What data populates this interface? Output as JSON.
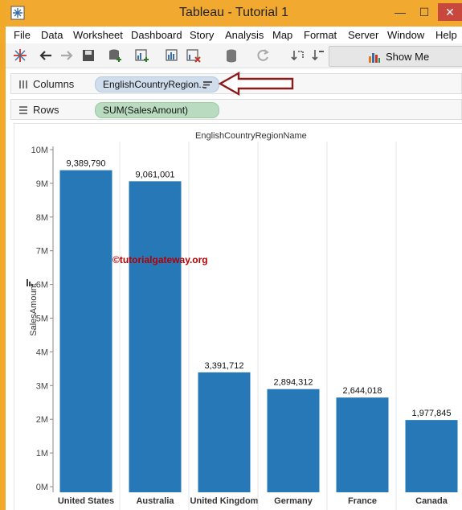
{
  "window": {
    "title": "Tableau - Tutorial 1",
    "minimize_glyph": "—",
    "maximize_glyph": "☐",
    "close_glyph": "✕"
  },
  "menu": [
    "File",
    "Data",
    "Worksheet",
    "Dashboard",
    "Story",
    "Analysis",
    "Map",
    "Format",
    "Server",
    "Window",
    "Help"
  ],
  "toolbar": {
    "icons": [
      "tableau-logo-icon",
      "back-icon",
      "forward-icon",
      "save-icon",
      "new-datasource-icon",
      "new-worksheet-icon",
      "duplicate-sheet-icon",
      "clear-sheet-icon",
      "datasource-icon",
      "refresh-icon",
      "swap-icon",
      "sort-icon"
    ],
    "show_me_label": "Show Me"
  },
  "shelves": {
    "columns": {
      "label": "Columns",
      "pill": "EnglishCountryRegion.."
    },
    "rows": {
      "label": "Rows",
      "pill": "SUM(SalesAmount)"
    }
  },
  "watermark": "©tutorialgateway.org",
  "colors": {
    "bar": "#2778b7",
    "titlebar": "#f2a930",
    "arrow": "#8b1a1a",
    "rows_pill": "#b9dcc1",
    "columns_pill": "#cfddec"
  },
  "chart_data": {
    "type": "bar",
    "title": "EnglishCountryRegionName",
    "xlabel": "",
    "ylabel": "SalesAmount",
    "categories": [
      "United States",
      "Australia",
      "United Kingdom",
      "Germany",
      "France",
      "Canada"
    ],
    "values": [
      9389790,
      9061001,
      3391712,
      2894312,
      2644018,
      1977845
    ],
    "data_labels": [
      "9,389,790",
      "9,061,001",
      "3,391,712",
      "2,894,312",
      "2,644,018",
      "1,977,845"
    ],
    "ylim": [
      0,
      10000000
    ],
    "yticks": [
      {
        "value": 0,
        "label": "0M"
      },
      {
        "value": 1000000,
        "label": "1M"
      },
      {
        "value": 2000000,
        "label": "2M"
      },
      {
        "value": 3000000,
        "label": "3M"
      },
      {
        "value": 4000000,
        "label": "4M"
      },
      {
        "value": 5000000,
        "label": "5M"
      },
      {
        "value": 6000000,
        "label": "6M"
      },
      {
        "value": 7000000,
        "label": "7M"
      },
      {
        "value": 8000000,
        "label": "8M"
      },
      {
        "value": 9000000,
        "label": "9M"
      },
      {
        "value": 10000000,
        "label": "10M"
      }
    ],
    "grid": false,
    "legend": "none"
  }
}
